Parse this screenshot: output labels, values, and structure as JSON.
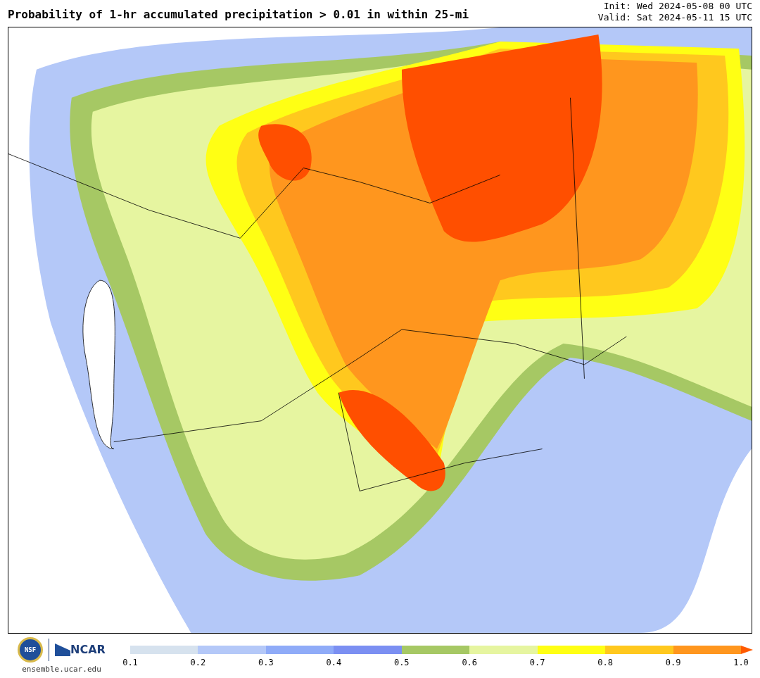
{
  "header": {
    "title": "Probability of 1-hr accumulated precipitation > 0.01 in within 25-mi",
    "init": "Init: Wed 2024-05-08 00 UTC",
    "valid": "Valid: Sat 2024-05-11 15 UTC"
  },
  "footer": {
    "nsf_logo": "NSF",
    "ncar_logo": "NCAR",
    "url": "ensemble.ucar.edu"
  },
  "colorbar": {
    "bins": [
      {
        "color": "#d6e2ee"
      },
      {
        "color": "#b4c8f8"
      },
      {
        "color": "#8fabf8"
      },
      {
        "color": "#7b8ff2"
      },
      {
        "color": "#a6c864"
      },
      {
        "color": "#e6f5a0"
      },
      {
        "color": "#ffff14"
      },
      {
        "color": "#ffc81e"
      },
      {
        "color": "#ff961e"
      },
      {
        "kind": "extend",
        "color": "#ff5a00"
      }
    ],
    "ticks": [
      "0.1",
      "0.2",
      "0.3",
      "0.4",
      "0.5",
      "0.6",
      "0.7",
      "0.8",
      "0.9",
      "1.0"
    ]
  }
}
